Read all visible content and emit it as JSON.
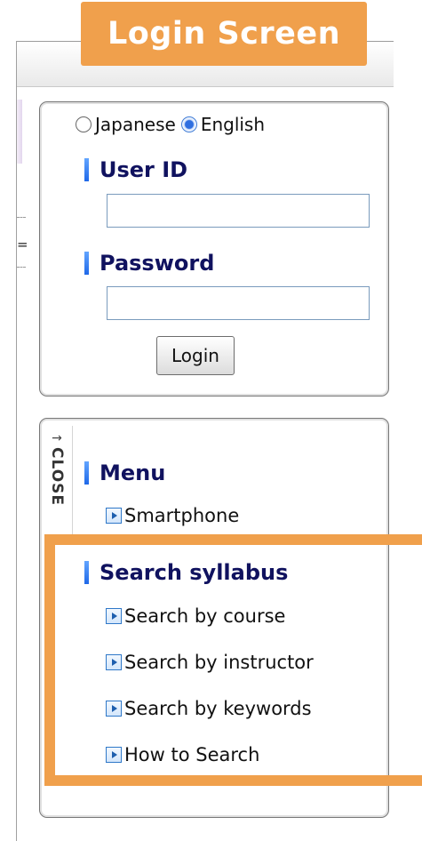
{
  "title_badge": "Login Screen",
  "language": {
    "options": [
      "Japanese",
      "English"
    ],
    "selected": "English"
  },
  "login_form": {
    "user_id_label": "User ID",
    "user_id_value": "",
    "password_label": "Password",
    "password_value": "",
    "login_button": "Login"
  },
  "menu_panel": {
    "close_tab": "CLOSE",
    "menu_heading": "Menu",
    "menu_items": [
      "Smartphone"
    ],
    "search_heading": "Search syllabus",
    "search_items": [
      "Search by course",
      "Search by instructor",
      "Search by keywords",
      "How to Search"
    ]
  },
  "colors": {
    "accent_orange": "#f0a04c",
    "heading_navy": "#10125f",
    "bar_blue": "#1f68e8"
  }
}
